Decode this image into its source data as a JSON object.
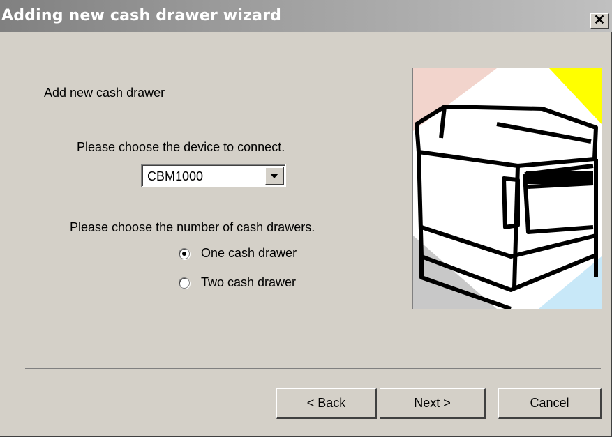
{
  "window": {
    "title": "Adding new cash drawer wizard",
    "close_glyph": "✕"
  },
  "content": {
    "heading": "Add new cash drawer",
    "device_prompt": "Please choose the device to connect.",
    "device_select": {
      "value": "CBM1000"
    },
    "count_prompt": "Please choose the number of cash drawers.",
    "radios": [
      {
        "label": "One cash drawer",
        "selected": true
      },
      {
        "label": "Two cash drawer",
        "selected": false
      }
    ],
    "illustration_icon": "printer-illustration"
  },
  "buttons": {
    "back": "< Back",
    "next": "Next >",
    "cancel": "Cancel"
  },
  "colors": {
    "face": "#d4d0c8",
    "title_gradient_start": "#808080",
    "title_gradient_end": "#c0c0c0",
    "illustration_yellow": "#ffff00",
    "illustration_pink": "#f2d4cc",
    "illustration_blue": "#c8e8f8"
  }
}
